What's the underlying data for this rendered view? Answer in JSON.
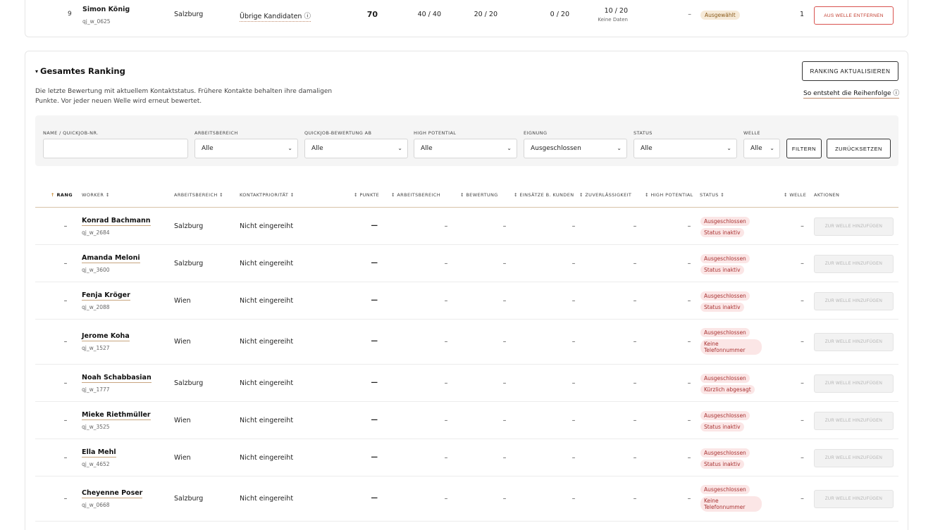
{
  "top_row": {
    "rank": "9",
    "name": "Simon König",
    "id": "qj_w_0625",
    "area": "Salzburg",
    "priority": "Übrige Kandidaten",
    "points": "70",
    "c1": "40 / 40",
    "c2": "20 / 20",
    "c3": "0 / 20",
    "c4": "10 / 20",
    "c4_note": "Keine Daten",
    "high_potential": "–",
    "status": "Ausgewählt",
    "wave": "1",
    "action": "AUS WELLE ENTFERNEN"
  },
  "section": {
    "toggle": "▾",
    "title": "Gesamtes Ranking",
    "description_1": "Die letzte Bewertung mit aktuellem Kontaktstatus. Frühere Kontakte behalten ihre damaligen",
    "description_2": "Punkte. Vor jeder neuen Welle wird erneut bewertet.",
    "refresh_button": "RANKING AKTUALISIEREN",
    "order_link": "So entsteht die Reihenfolge ⓘ"
  },
  "filters": {
    "name_label": "NAME / QUICKJOB-NR.",
    "name_value": "",
    "area_label": "ARBEITSBEREICH",
    "area_value": "Alle",
    "rating_label": "QUICKJOB-BEWERTUNG AB",
    "rating_value": "Alle",
    "hp_label": "HIGH POTENTIAL",
    "hp_value": "Alle",
    "fit_label": "EIGNUNG",
    "fit_value": "Ausgeschlossen",
    "status_label": "STATUS",
    "status_value": "Alle",
    "wave_label": "WELLE",
    "wave_value": "Alle",
    "filter_button": "FILTERN",
    "reset_button": "ZURÜCKSETZEN"
  },
  "table": {
    "headers": {
      "rank": "RANG",
      "worker": "WORKER",
      "area": "ARBEITSBEREICH",
      "priority": "KONTAKTPRIORITÄT",
      "points": "PUNKTE",
      "area2": "ARBEITSBEREICH",
      "rating": "BEWERTUNG",
      "missions": "EINSÄTZE B. KUNDEN",
      "reliability": "ZUVERLÄSSIGKEIT",
      "hp": "HIGH POTENTIAL",
      "status": "STATUS",
      "wave": "WELLE",
      "actions": "AKTIONEN"
    },
    "sort_glyph": "↕",
    "rank_sort_glyph": "↑",
    "dash": "–",
    "points_dash": "—",
    "action_label": "ZUR WELLE HINZUFÜGEN",
    "priority_value": "Nicht eingereiht",
    "rows": [
      {
        "name": "Konrad Bachmann",
        "id": "qj_w_2684",
        "area": "Salzburg",
        "badges": [
          "Ausgeschlossen",
          "Status inaktiv"
        ]
      },
      {
        "name": "Amanda Meloni",
        "id": "qj_w_3600",
        "area": "Salzburg",
        "badges": [
          "Ausgeschlossen",
          "Status inaktiv"
        ]
      },
      {
        "name": "Fenja Kröger",
        "id": "qj_w_2088",
        "area": "Wien",
        "badges": [
          "Ausgeschlossen",
          "Status inaktiv"
        ]
      },
      {
        "name": "Jerome Koha",
        "id": "qj_w_1527",
        "area": "Wien",
        "badges": [
          "Ausgeschlossen",
          "Keine Telefonnummer"
        ]
      },
      {
        "name": "Noah Schabbasian",
        "id": "qj_w_1777",
        "area": "Salzburg",
        "badges": [
          "Ausgeschlossen",
          "Kürzlich abgesagt"
        ]
      },
      {
        "name": "Mieke Riethmüller",
        "id": "qj_w_3525",
        "area": "Wien",
        "badges": [
          "Ausgeschlossen",
          "Status inaktiv"
        ]
      },
      {
        "name": "Ella Mehl",
        "id": "qj_w_4652",
        "area": "Wien",
        "badges": [
          "Ausgeschlossen",
          "Status inaktiv"
        ]
      },
      {
        "name": "Cheyenne Poser",
        "id": "qj_w_0668",
        "area": "Salzburg",
        "badges": [
          "Ausgeschlossen",
          "Keine Telefonnummer"
        ]
      }
    ]
  },
  "colors": {
    "accent": "#c8872b",
    "danger": "#c0392b",
    "badge_excluded_bg": "#fbe6e6",
    "badge_selected_bg": "#f6ead8"
  }
}
